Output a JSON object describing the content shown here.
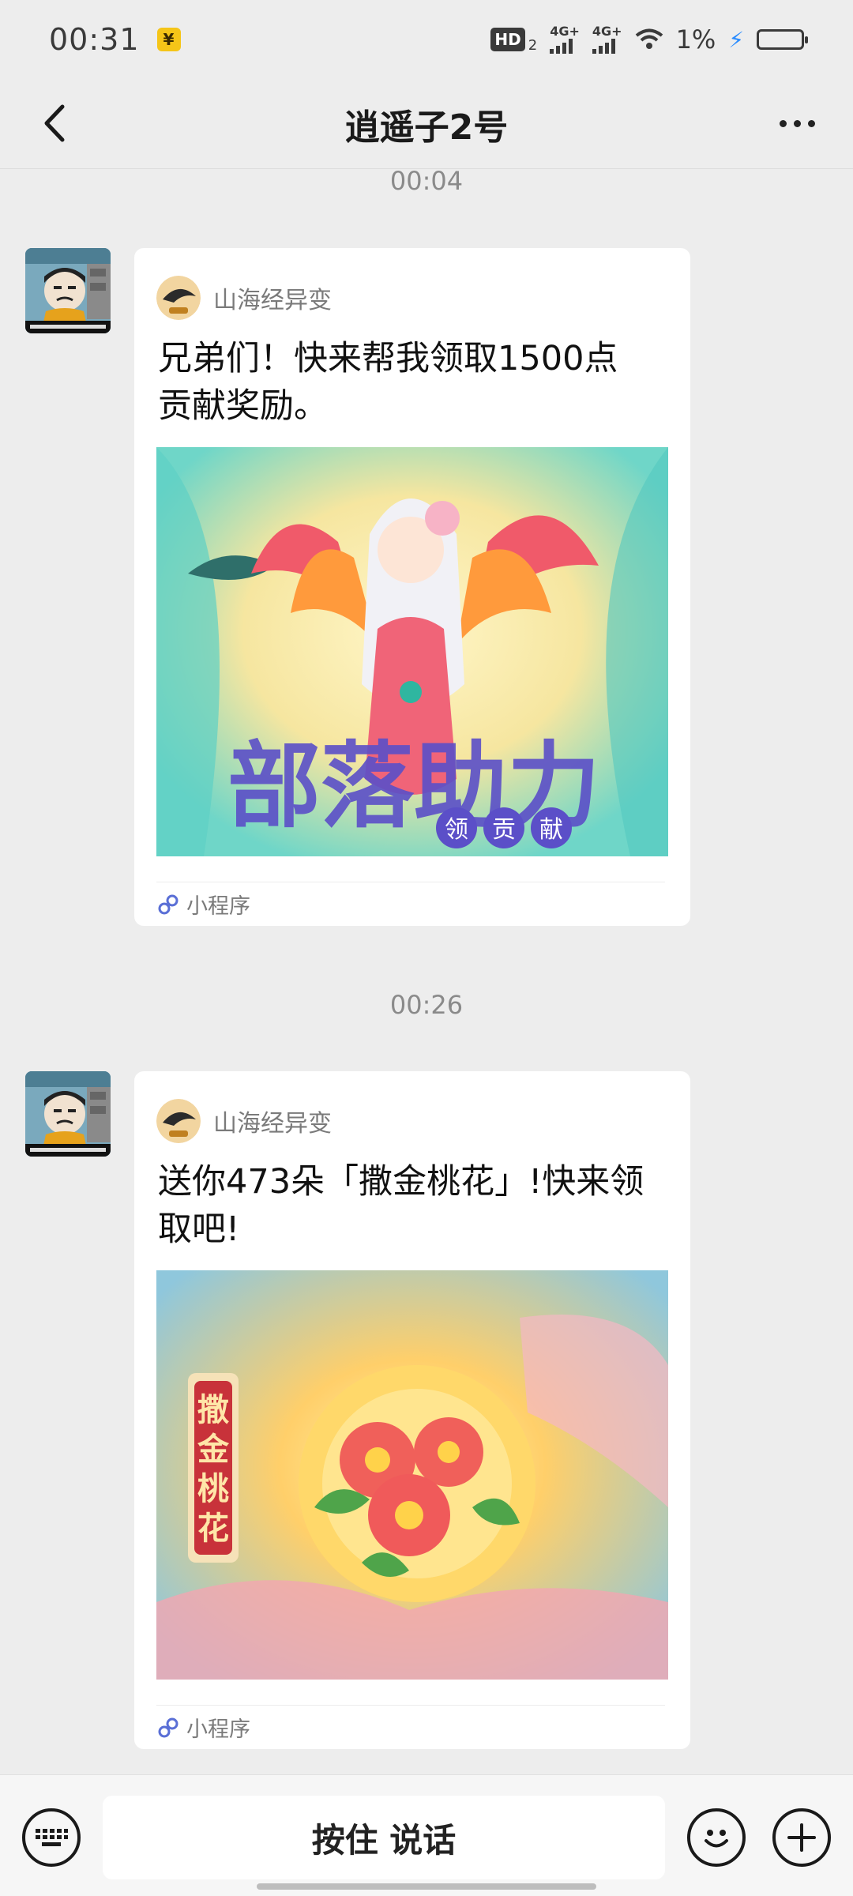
{
  "status_bar": {
    "time": "00:31",
    "yuan_badge": "¥",
    "hd": "HD",
    "hd_sub": "2",
    "signal1_label": "4G+",
    "signal2_label": "4G+",
    "battery_percent": "1%"
  },
  "nav": {
    "title": "逍遥子2号",
    "back_icon": "chevron-left-icon",
    "more_icon": "more-dots-icon"
  },
  "messages": [
    {
      "time": "00:04",
      "source_name": "山海经异变",
      "text_line1": "兄弟们！快来帮我领取1500点",
      "text_line2": "贡献奖励。",
      "image_title": "部落助力",
      "image_subtitle": [
        "领",
        "贡",
        "献"
      ],
      "footer_label": "小程序"
    },
    {
      "time": "00:26",
      "source_name": "山海经异变",
      "text_line1": "送你473朵「撒金桃花」!快来领",
      "text_line2": "取吧!",
      "image_banner": [
        "撒",
        "金",
        "桃",
        "花"
      ],
      "footer_label": "小程序"
    }
  ],
  "bottom_bar": {
    "talk_label": "按住 说话",
    "keyboard_icon": "keyboard-icon",
    "emoji_icon": "emoji-icon",
    "plus_icon": "plus-icon"
  },
  "colors": {
    "background": "#ededed",
    "card": "#ffffff",
    "accent_blue": "#2a8cff"
  }
}
